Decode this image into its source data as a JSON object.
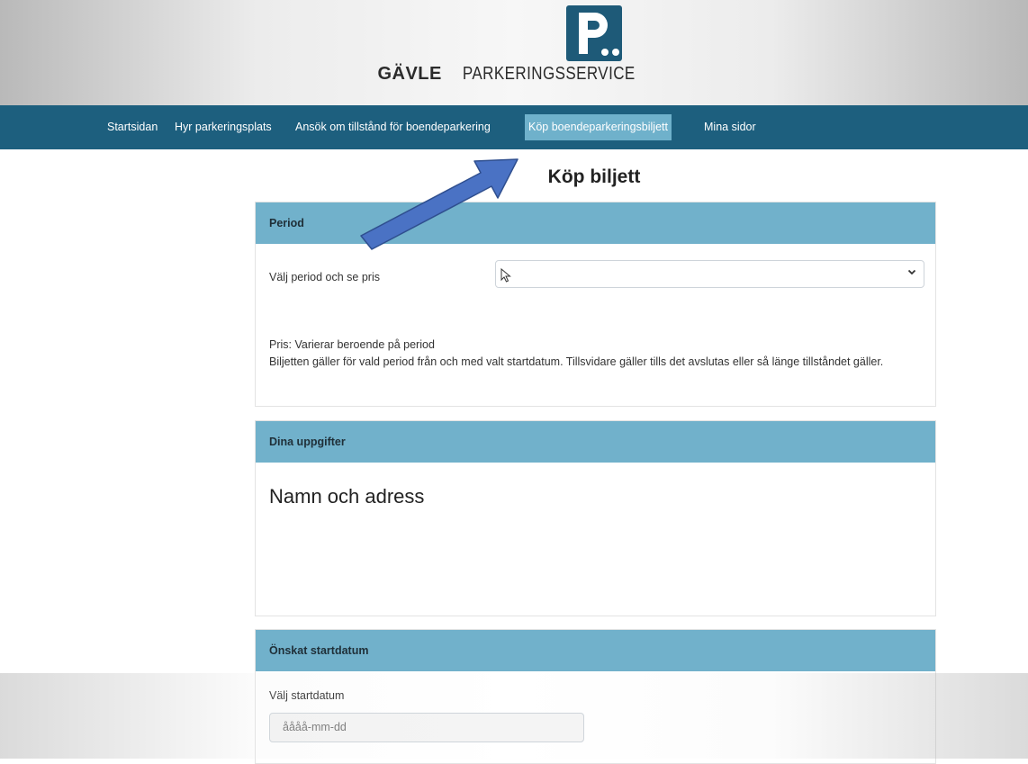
{
  "brand": {
    "name_bold": "GÄVLE",
    "name_rest": "PARKERINGSSERVICE",
    "logo_letter": "P",
    "logo_color": "#1e5a78"
  },
  "nav": {
    "items": [
      {
        "label": "Startsidan"
      },
      {
        "label": "Hyr parkeringsplats"
      },
      {
        "label": "Ansök om tillstånd för boendeparkering"
      },
      {
        "label": "Köp boendeparkeringsbiljett",
        "active": true
      },
      {
        "label": "Mina sidor"
      }
    ]
  },
  "page": {
    "title": "Köp biljett"
  },
  "period": {
    "header": "Period",
    "select_label": "Välj period och se pris",
    "select_value": "",
    "price_text": "Pris: Varierar beroende på period",
    "info_text": "Biljetten gäller för vald period från och med valt startdatum. Tillsvidare gäller tills det avslutas eller så länge tillståndet gäller."
  },
  "details": {
    "header": "Dina uppgifter",
    "subheading": "Namn och adress"
  },
  "start": {
    "header": "Önskat startdatum",
    "label": "Välj startdatum",
    "placeholder": "åååå-mm-dd"
  },
  "colors": {
    "nav_bg": "#1d5f7e",
    "nav_active": "#6fb1cb",
    "card_header": "#71b1cb",
    "arrow": "#4a72c4"
  }
}
